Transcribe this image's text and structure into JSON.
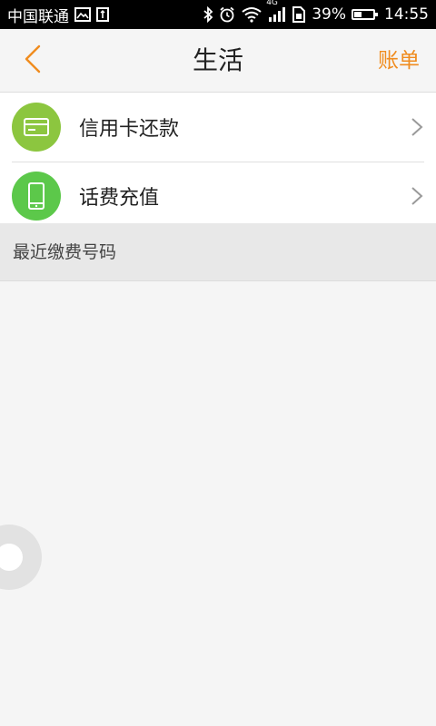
{
  "status_bar": {
    "carrier": "中国联通",
    "network": "4G",
    "battery_percent": "39%",
    "battery_level": 0.39,
    "time": "14:55",
    "icons": [
      "gallery-icon",
      "usb-icon",
      "bluetooth-icon",
      "alarm-icon",
      "wifi-icon",
      "signal-icon",
      "sim-icon",
      "battery-icon"
    ]
  },
  "nav": {
    "title": "生活",
    "action_label": "账单",
    "back_icon": "chevron-left-icon"
  },
  "list": {
    "items": [
      {
        "label": "信用卡还款",
        "icon": "credit-card-icon",
        "icon_color": "#8cc63f"
      },
      {
        "label": "话费充值",
        "icon": "phone-icon",
        "icon_color": "#5cc84a"
      }
    ]
  },
  "section": {
    "recent_title": "最近缴费号码"
  },
  "colors": {
    "accent": "#f08c1f",
    "background": "#f5f5f5",
    "section_bg": "#e8e8e8"
  }
}
